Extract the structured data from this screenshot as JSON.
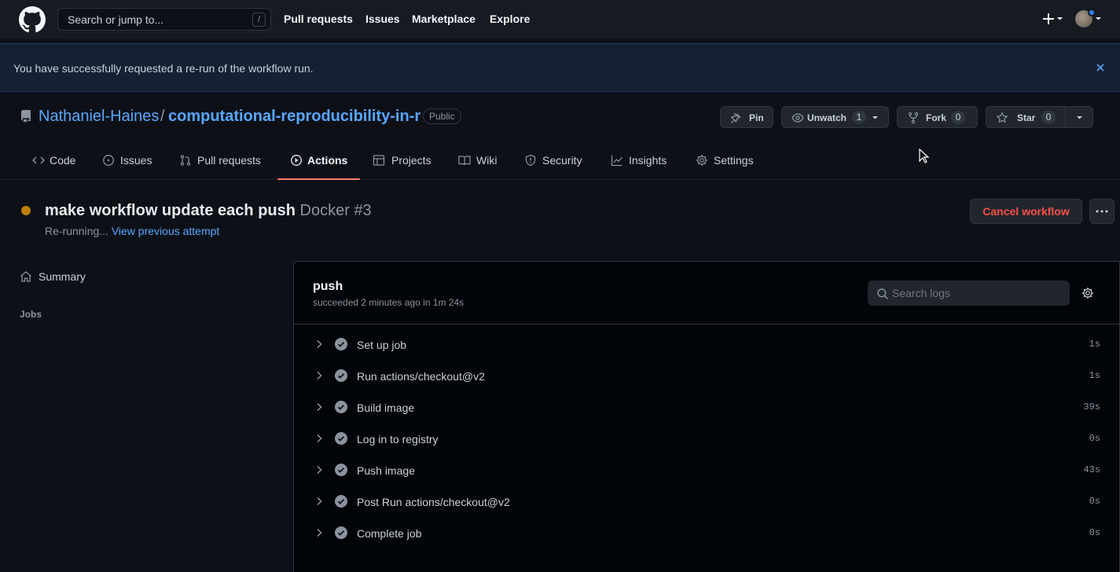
{
  "header": {
    "search_placeholder": "Search or jump to...",
    "search_shortcut": "/",
    "nav": [
      "Pull requests",
      "Issues",
      "Marketplace",
      "Explore"
    ]
  },
  "flash": {
    "message": "You have successfully requested a re-run of the workflow run."
  },
  "repo": {
    "owner": "Nathaniel-Haines",
    "separator": "/",
    "name": "computational-reproducibility-in-r",
    "visibility": "Public",
    "pin_label": "Pin",
    "unwatch_label": "Unwatch",
    "watch_count": "1",
    "fork_label": "Fork",
    "fork_count": "0",
    "star_label": "Star",
    "star_count": "0"
  },
  "tabs": [
    {
      "label": "Code",
      "icon": "code-icon"
    },
    {
      "label": "Issues",
      "icon": "issue-icon"
    },
    {
      "label": "Pull requests",
      "icon": "pull-request-icon"
    },
    {
      "label": "Actions",
      "icon": "play-icon",
      "active": true
    },
    {
      "label": "Projects",
      "icon": "table-icon"
    },
    {
      "label": "Wiki",
      "icon": "book-icon"
    },
    {
      "label": "Security",
      "icon": "shield-icon"
    },
    {
      "label": "Insights",
      "icon": "graph-icon"
    },
    {
      "label": "Settings",
      "icon": "gear-icon"
    }
  ],
  "run": {
    "title": "make workflow update each push",
    "workflow": "Docker #3",
    "status_text": "Re-running...",
    "previous_attempt_link": "View previous attempt",
    "cancel_label": "Cancel workflow",
    "status_color": "#bb8009"
  },
  "sidebar": {
    "summary_label": "Summary",
    "jobs_heading": "Jobs"
  },
  "job": {
    "name": "push",
    "meta": "succeeded 2 minutes ago in 1m 24s",
    "search_placeholder": "Search logs",
    "steps": [
      {
        "label": "Set up job",
        "duration": "1s"
      },
      {
        "label": "Run actions/checkout@v2",
        "duration": "1s"
      },
      {
        "label": "Build image",
        "duration": "39s"
      },
      {
        "label": "Log in to registry",
        "duration": "0s"
      },
      {
        "label": "Push image",
        "duration": "43s"
      },
      {
        "label": "Post Run actions/checkout@v2",
        "duration": "0s"
      },
      {
        "label": "Complete job",
        "duration": "0s"
      }
    ]
  },
  "colors": {
    "accent_link": "#58a6ff",
    "active_tab_underline": "#f78166",
    "danger": "#f85149"
  }
}
